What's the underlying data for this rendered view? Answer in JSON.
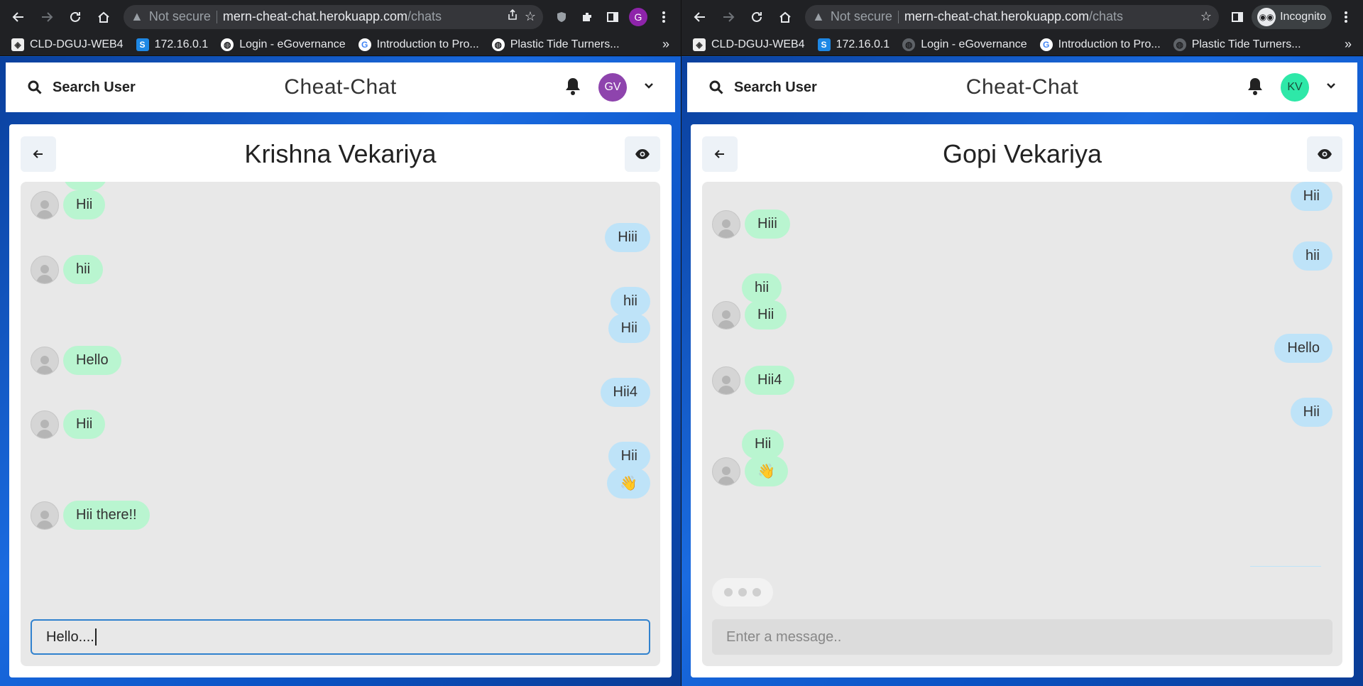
{
  "left": {
    "tab": {
      "security": "Not secure",
      "url_host": "mern-cheat-chat.herokuapp.com",
      "url_path": "/chats",
      "profile_initial": "G"
    },
    "bookmarks": [
      "CLD-DGUJ-WEB4",
      "172.16.0.1",
      "Login - eGovernance",
      "Introduction to Pro...",
      "Plastic Tide Turners..."
    ],
    "bookmarks_more": "»",
    "appbar": {
      "search_label": "Search User",
      "title": "Cheat-Chat",
      "avatar_initials": "GV",
      "avatar_color": "#8e44ad"
    },
    "chat": {
      "name": "Krishna Vekariya",
      "input_value": "Hello....",
      "messages": [
        {
          "dir": "in",
          "text": "Hii",
          "pic": true
        },
        {
          "dir": "out",
          "text": "Hiii"
        },
        {
          "dir": "in",
          "text": "hii",
          "pic": true
        },
        {
          "dir": "out",
          "text": "hii"
        },
        {
          "dir": "out",
          "text": "Hii"
        },
        {
          "dir": "in",
          "text": "Hello",
          "pic": true
        },
        {
          "dir": "out",
          "text": "Hii4"
        },
        {
          "dir": "in",
          "text": "Hii",
          "pic": true
        },
        {
          "dir": "out",
          "text": "Hii"
        },
        {
          "dir": "out",
          "text": "👋"
        },
        {
          "dir": "in",
          "text": "Hii there!!",
          "pic": true
        }
      ]
    }
  },
  "right": {
    "tab": {
      "security": "Not secure",
      "url_host": "mern-cheat-chat.herokuapp.com",
      "url_path": "/chats",
      "incognito_label": "Incognito"
    },
    "bookmarks": [
      "CLD-DGUJ-WEB4",
      "172.16.0.1",
      "Login - eGovernance",
      "Introduction to Pro...",
      "Plastic Tide Turners..."
    ],
    "bookmarks_more": "»",
    "appbar": {
      "search_label": "Search User",
      "title": "Cheat-Chat",
      "avatar_initials": "KV",
      "avatar_color": "#2ee8a8"
    },
    "chat": {
      "name": "Gopi Vekariya",
      "input_placeholder": "Enter a message..",
      "messages": [
        {
          "dir": "out",
          "text": "Hii"
        },
        {
          "dir": "in",
          "text": "Hiii",
          "pic": true
        },
        {
          "dir": "out",
          "text": "hii"
        },
        {
          "dir": "in",
          "text": "hii",
          "pic": false
        },
        {
          "dir": "in",
          "text": "Hii",
          "pic": true
        },
        {
          "dir": "out",
          "text": "Hello"
        },
        {
          "dir": "in",
          "text": "Hii4",
          "pic": true
        },
        {
          "dir": "out",
          "text": "Hii"
        },
        {
          "dir": "in",
          "text": "Hii",
          "pic": false
        },
        {
          "dir": "in",
          "text": "👋",
          "pic": true
        }
      ]
    }
  }
}
